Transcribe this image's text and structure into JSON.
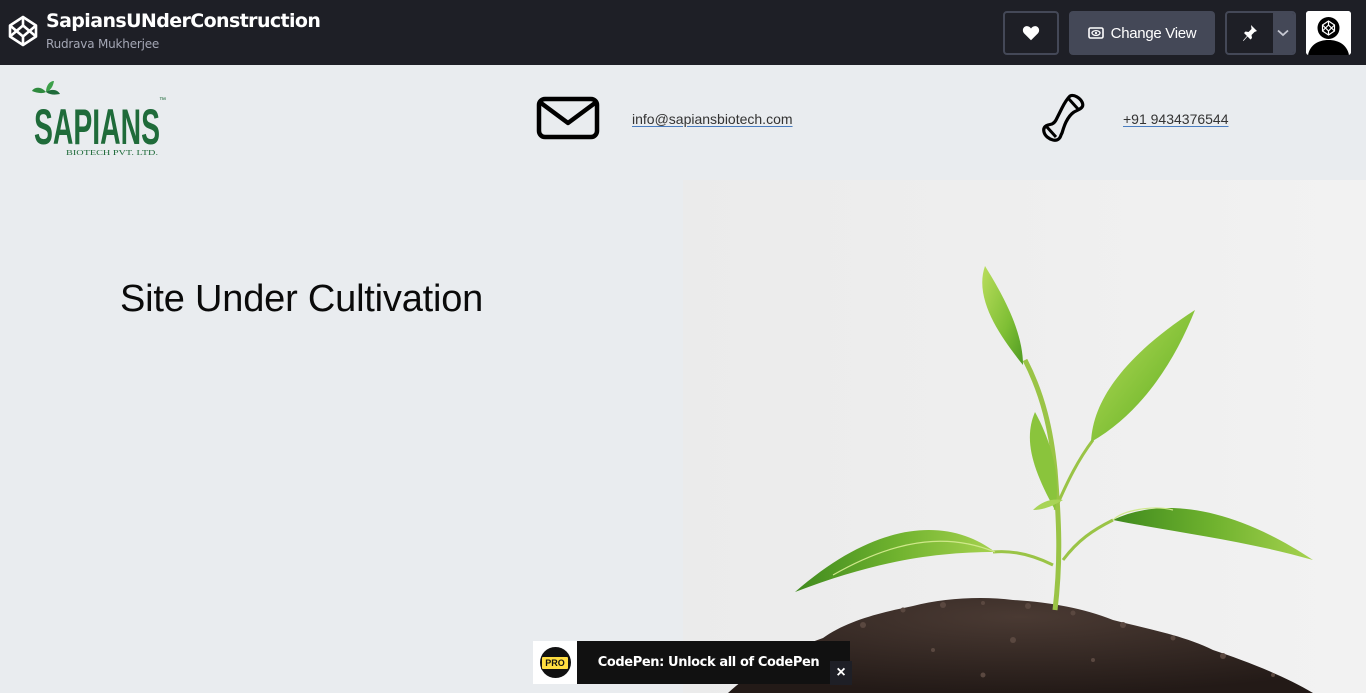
{
  "codepen": {
    "pen_title": "SapiansUNderConstruction",
    "author": "Rudrava Mukherjee",
    "change_view_label": "Change View"
  },
  "header": {
    "logo_text": "SAPIANS",
    "logo_tm": "™",
    "logo_subtext": "BIOTECH PVT. LTD.",
    "email": "info@sapiansbiotech.com",
    "phone": "+91 9434376544"
  },
  "hero": {
    "title": "Site Under Cultivation"
  },
  "promo": {
    "badge": "PRO",
    "text": "CodePen: Unlock all of CodePen",
    "close": "×"
  },
  "colors": {
    "topbar": "#1e1f26",
    "button": "#444857",
    "page_bg": "#e9ecef",
    "brand_green": "#1f6b3a",
    "leaf_green": "#8cc63f",
    "pro_yellow": "#ffdd40"
  },
  "icons": [
    "codepen-logo-icon",
    "heart-icon",
    "eye-icon",
    "pin-icon",
    "chevron-down-icon",
    "mail-icon",
    "phone-icon"
  ]
}
